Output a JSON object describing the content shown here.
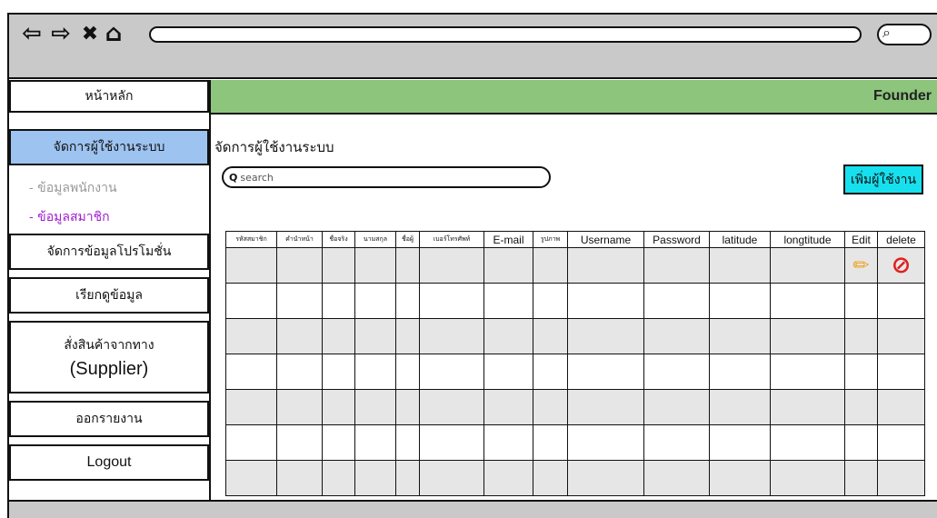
{
  "browser": {
    "back_icon": "⇦",
    "forward_icon": "⇨",
    "close_icon": "✖",
    "home_icon": "⌂",
    "search_icon": "⌕"
  },
  "header": {
    "brand": "Founder"
  },
  "sidebar": {
    "home": "หน้าหลัก",
    "manage_users": "จัดการผู้ใช้งานระบบ",
    "sub_employee": "- ข้อมูลพนักงาน",
    "sub_member": "- ข้อมูลสมาชิก",
    "manage_promotion": "จัดการข้อมูลโปรโมชั่น",
    "view_data": "เรียกดูข้อมูล",
    "order_line1": "สั่งสินค้าจากทาง",
    "order_line2": "(Supplier)",
    "report": "ออกรายงาน",
    "logout": "Logout"
  },
  "main": {
    "title": "จัดการผู้ใช้งานระบบ",
    "search_placeholder": "search",
    "add_user_label": "เพิ่มผู้ใช้งาน"
  },
  "table": {
    "columns": [
      "รหัสสมาชิก",
      "คำนำหน้า",
      "ชื่อจริง",
      "นามสกุล",
      "ชื่อผู้",
      "เบอร์โทรศัพท์",
      "E-mail",
      "รูปภาพ",
      "Username",
      "Password",
      "latitude",
      "longtitude",
      "Edit",
      "delete"
    ],
    "edit_icon": "✏",
    "delete_icon": "⊘"
  },
  "colors": {
    "accent_green": "#8dc57c",
    "active_blue": "#9dc3f0",
    "add_button": "#17e0ee",
    "member_purple": "#a21ccf"
  }
}
